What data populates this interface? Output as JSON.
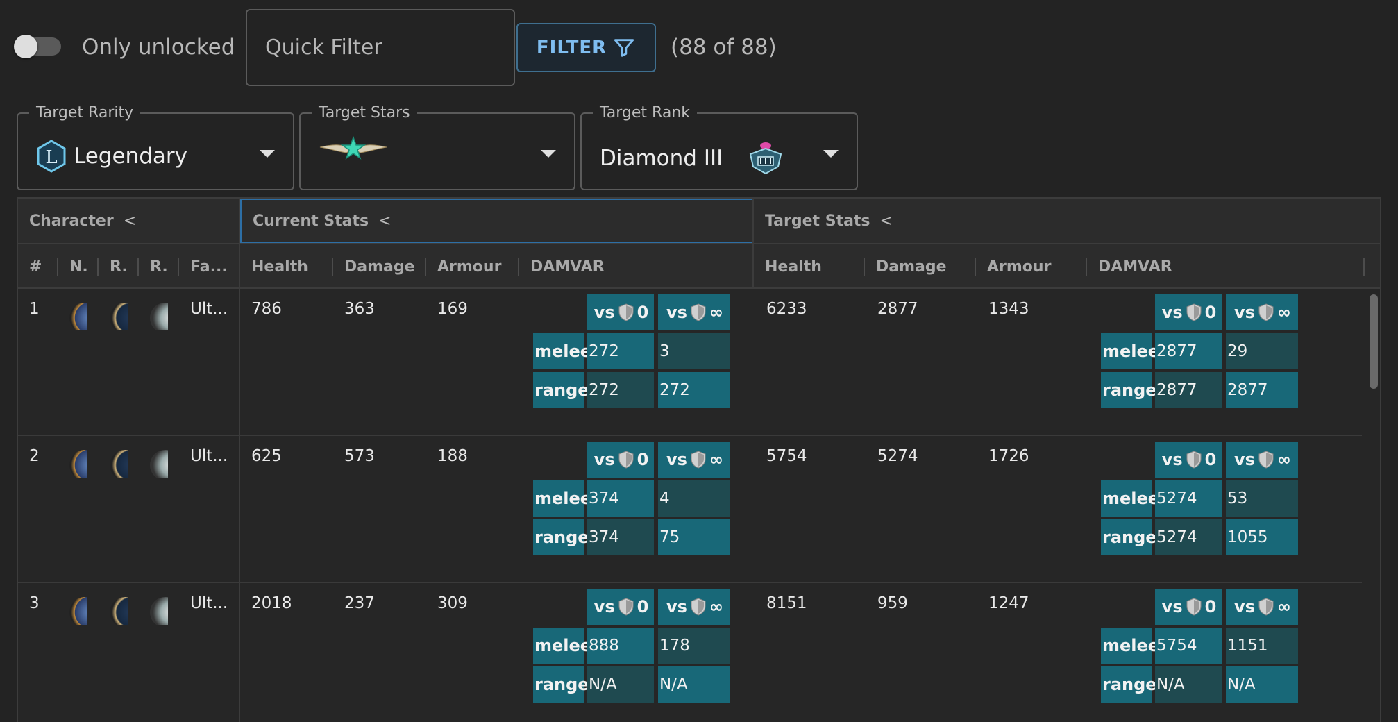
{
  "toolbar": {
    "only_unlocked_label": "Only unlocked",
    "quick_filter_placeholder": "Quick Filter",
    "filter_label": "FILTER",
    "count_text": "(88 of 88)"
  },
  "selectors": {
    "rarity": {
      "label": "Target Rarity",
      "value": "Legendary",
      "badge": "L"
    },
    "stars": {
      "label": "Target Stars",
      "value": ""
    },
    "rank": {
      "label": "Target Rank",
      "value": "Diamond III"
    }
  },
  "grid": {
    "groups": {
      "character": "Character",
      "current": "Current Stats",
      "target": "Target Stats"
    },
    "headers": {
      "num": "#",
      "name": "N.",
      "r1": "R.",
      "r2": "R.",
      "faction": "Fa...",
      "health": "Health",
      "damage": "Damage",
      "armour": "Armour",
      "damvar": "DAMVAR"
    },
    "damvar_labels": {
      "vs": "vs",
      "zero": "0",
      "inf": "∞",
      "melee": "melee",
      "range": "range"
    },
    "rows": [
      {
        "num": "1",
        "faction": "Ult...",
        "current": {
          "health": "786",
          "damage": "363",
          "armour": "169",
          "melee0": "272",
          "meleeInf": "3",
          "range0": "272",
          "rangeInf": "272"
        },
        "target": {
          "health": "6233",
          "damage": "2877",
          "armour": "1343",
          "melee0": "2877",
          "meleeInf": "29",
          "range0": "2877",
          "rangeInf": "2877"
        }
      },
      {
        "num": "2",
        "faction": "Ult...",
        "current": {
          "health": "625",
          "damage": "573",
          "armour": "188",
          "melee0": "374",
          "meleeInf": "4",
          "range0": "374",
          "rangeInf": "75"
        },
        "target": {
          "health": "5754",
          "damage": "5274",
          "armour": "1726",
          "melee0": "5274",
          "meleeInf": "53",
          "range0": "5274",
          "rangeInf": "1055"
        }
      },
      {
        "num": "3",
        "faction": "Ult...",
        "current": {
          "health": "2018",
          "damage": "237",
          "armour": "309",
          "melee0": "888",
          "meleeInf": "178",
          "range0": "N/A",
          "rangeInf": "N/A"
        },
        "target": {
          "health": "8151",
          "damage": "959",
          "armour": "1247",
          "melee0": "5754",
          "meleeInf": "1151",
          "range0": "N/A",
          "rangeInf": "N/A"
        }
      }
    ]
  },
  "colors": {
    "cell_primary": "#186878",
    "cell_secondary": "#1f4a50",
    "accent": "#7fbdf0"
  }
}
